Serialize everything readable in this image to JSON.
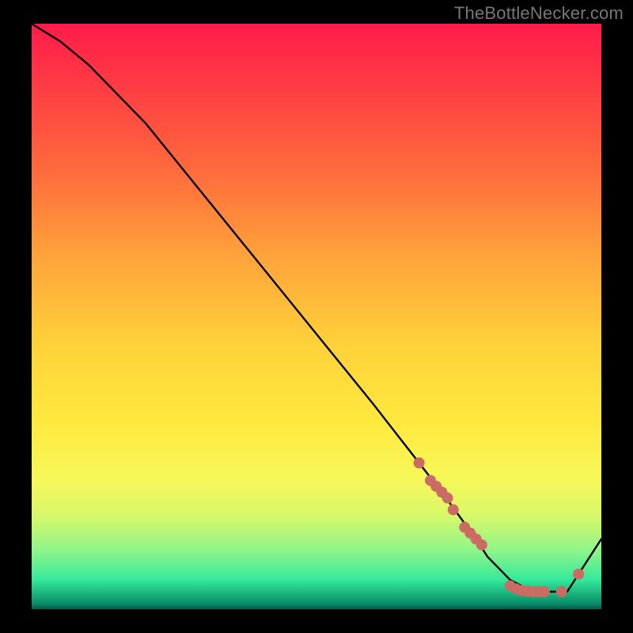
{
  "watermark": "TheBottleNecker.com",
  "chart_data": {
    "type": "line",
    "title": "",
    "xlabel": "",
    "ylabel": "",
    "xlim": [
      0,
      100
    ],
    "ylim": [
      0,
      100
    ],
    "series": [
      {
        "name": "curve",
        "x": [
          0,
          5,
          10,
          20,
          30,
          40,
          50,
          60,
          68,
          72,
          75,
          78,
          80,
          82,
          84,
          86,
          88,
          90,
          92,
          94,
          96,
          100
        ],
        "y": [
          100,
          97,
          93,
          83,
          71,
          59,
          47,
          35,
          25,
          20,
          16,
          12,
          9,
          7,
          5,
          4,
          3,
          3,
          3,
          3,
          6,
          12
        ]
      }
    ],
    "markers": {
      "name": "marker-points",
      "series": "curve",
      "x": [
        68,
        70,
        71,
        72,
        73,
        74,
        76,
        77,
        78,
        79,
        84,
        85,
        86,
        87,
        88,
        89,
        90,
        93,
        96
      ],
      "y": [
        25,
        22,
        21,
        20,
        19,
        17,
        14,
        13,
        12,
        11,
        4,
        3.5,
        3.2,
        3.1,
        3.0,
        3.0,
        3.0,
        3.0,
        6
      ],
      "radius": 7
    },
    "background_gradient": {
      "stops": [
        {
          "pos": 0,
          "color": "#ff1b4a"
        },
        {
          "pos": 55,
          "color": "#ffd23a"
        },
        {
          "pos": 95,
          "color": "#33e89a"
        },
        {
          "pos": 100,
          "color": "#055a48"
        }
      ]
    }
  }
}
